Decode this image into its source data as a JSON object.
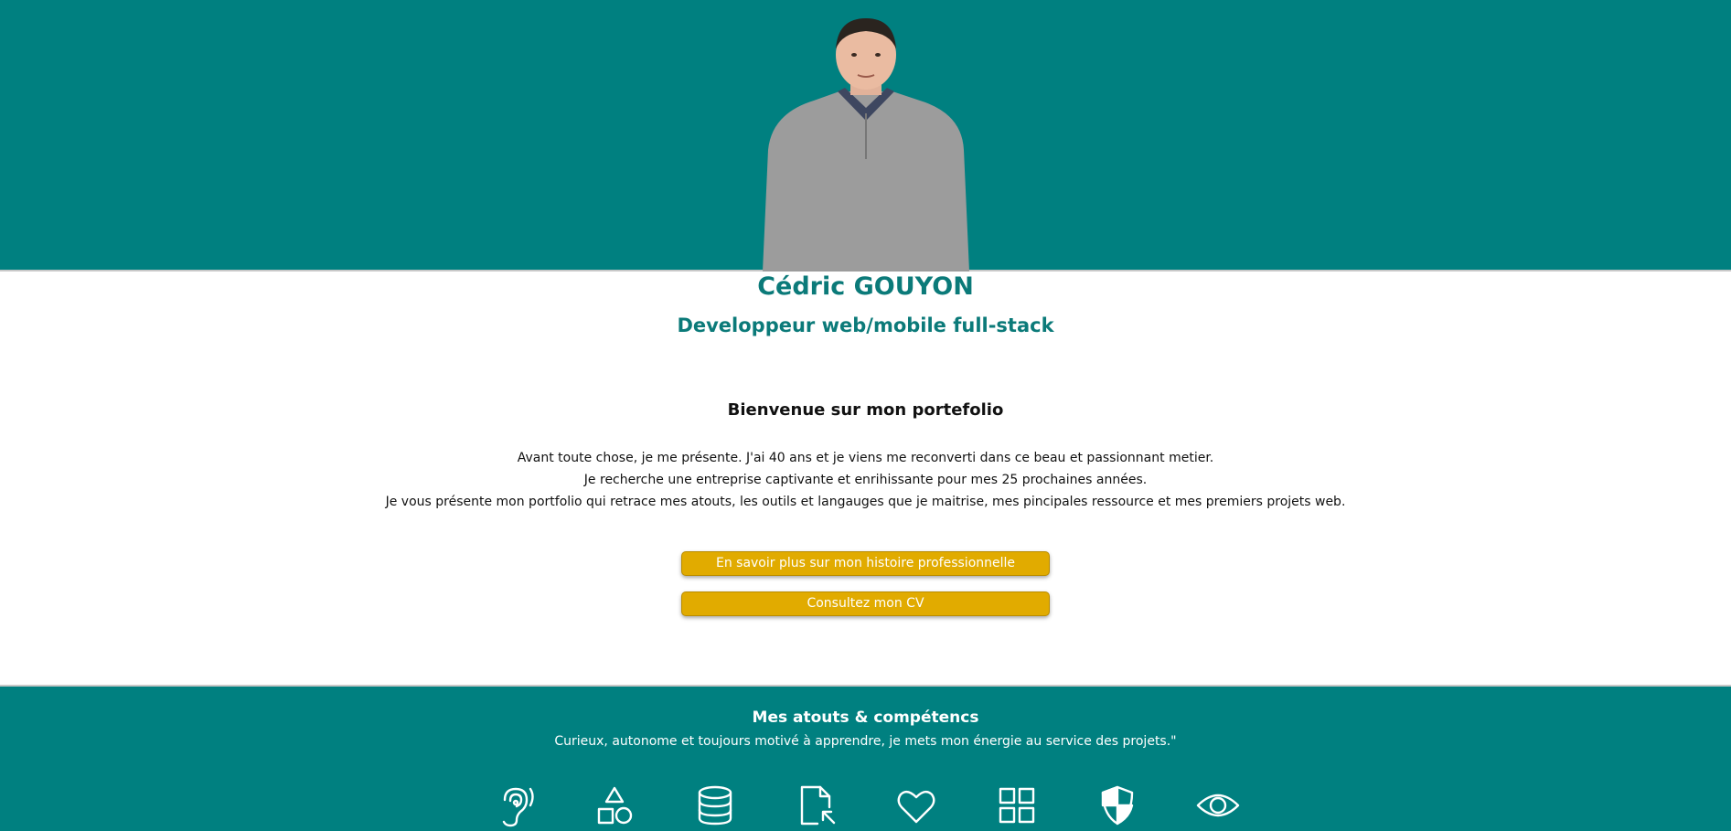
{
  "profile": {
    "name": "Cédric GOUYON",
    "role": "Developpeur web/mobile full-stack"
  },
  "intro": {
    "heading": "Bienvenue sur mon portefolio",
    "lines": [
      "Avant toute chose, je me présente. J'ai 40 ans et je viens me reconverti dans ce beau et passionnant metier.",
      "Je recherche une entreprise captivante et enrihissante pour mes 25 prochaines années.",
      "Je vous présente mon portfolio qui retrace mes atouts, les outils et langauges que je maitrise, mes pincipales ressource et mes premiers projets web."
    ]
  },
  "buttons": {
    "history": "En savoir plus sur mon histoire professionnelle",
    "cv": "Consultez mon CV"
  },
  "skills": {
    "title": "Mes atouts & compétencs",
    "subtitle": "Curieux, autonome et toujours motivé à apprendre, je mets mon énergie au service des projets.\"",
    "icons": [
      "ear-icon",
      "shapes-icon",
      "database-icon",
      "file-cursor-icon",
      "heart-icon",
      "grid-icon",
      "shield-icon",
      "eye-icon"
    ]
  },
  "colors": {
    "teal": "#008080",
    "name_teal": "#0b7a79",
    "button_gold": "#e1ab00"
  }
}
